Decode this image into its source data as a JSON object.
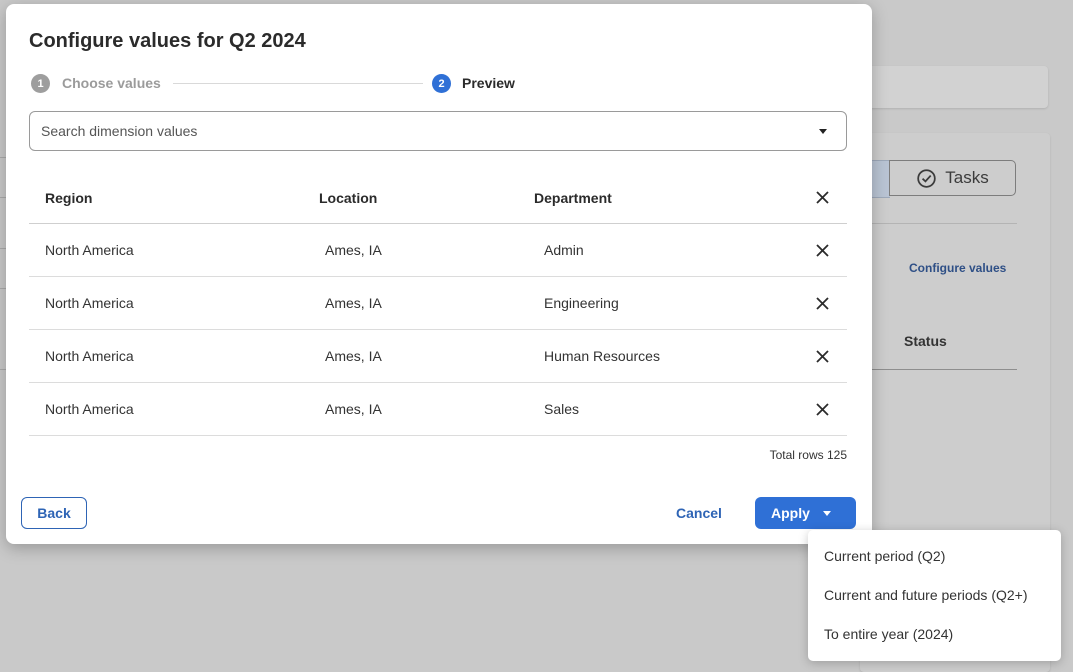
{
  "background": {
    "tasks_tab_label": "Tasks",
    "configure_values_link": "Configure values",
    "status_header": "Status"
  },
  "modal": {
    "title": "Configure values for Q2 2024",
    "steps": [
      {
        "number": "1",
        "label": "Choose values",
        "state": "completed"
      },
      {
        "number": "2",
        "label": "Preview",
        "state": "active"
      }
    ],
    "search": {
      "placeholder": "Search dimension values",
      "value": ""
    },
    "table": {
      "columns": [
        "Region",
        "Location",
        "Department"
      ],
      "rows": [
        [
          "North America",
          "Ames, IA",
          "Admin"
        ],
        [
          "North America",
          "Ames, IA",
          "Engineering"
        ],
        [
          "North America",
          "Ames, IA",
          "Human Resources"
        ],
        [
          "North America",
          "Ames, IA",
          "Sales"
        ]
      ]
    },
    "total_rows": "Total rows 125",
    "buttons": {
      "back": "Back",
      "cancel": "Cancel",
      "apply": "Apply"
    }
  },
  "apply_menu": {
    "items": [
      "Current period (Q2)",
      "Current and future periods (Q2+)",
      "To entire year (2024)"
    ]
  },
  "colors": {
    "accent": "#2f70d6",
    "link": "#2e64b5",
    "overlay": "#c9c9c9",
    "inactive_step": "#9e9e9e"
  },
  "icons": {
    "remove": "close-icon",
    "dropdown": "caret-down-icon",
    "tasks": "check-circle-icon"
  }
}
